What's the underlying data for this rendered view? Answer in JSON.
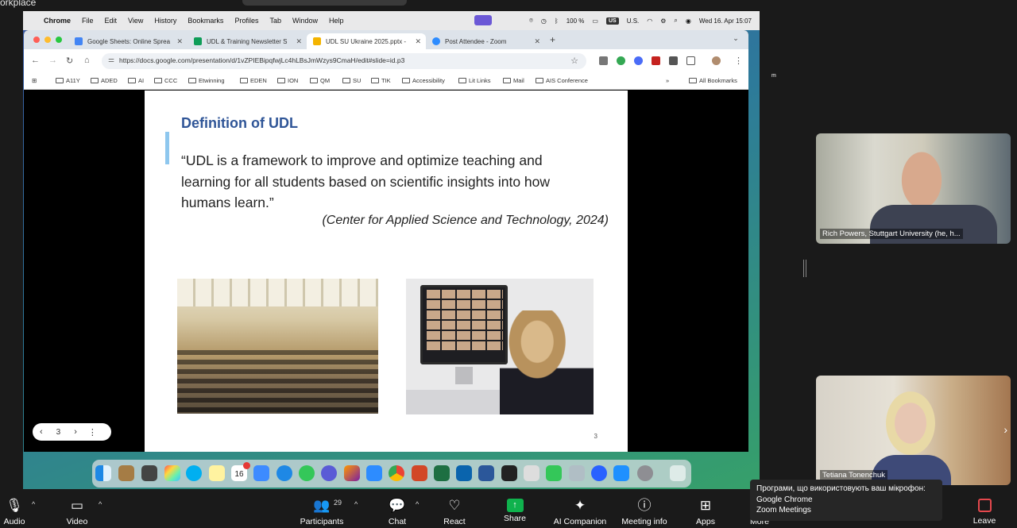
{
  "corner_text": "orkplace",
  "menubar": {
    "app": "Chrome",
    "items": [
      "File",
      "Edit",
      "View",
      "History",
      "Bookmarks",
      "Profiles",
      "Tab",
      "Window",
      "Help"
    ],
    "battery": "100 %",
    "input_source": "US",
    "input_source_label": "U.S.",
    "datetime": "Wed 16. Apr  15:07"
  },
  "browser": {
    "tabs": [
      {
        "title": "Google Sheets: Online Sprea",
        "color": "#4285f4"
      },
      {
        "title": "UDL & Training Newsletter S",
        "color": "#0f9d58"
      },
      {
        "title": "UDL SU Ukraine 2025.pptx -",
        "color": "#f4b400"
      },
      {
        "title": "Post Attendee - Zoom",
        "color": "#2d8cff"
      }
    ],
    "url": "https://docs.google.com/presentation/d/1vZPIEBipqfwjLc4hLBsJmWzys9CmaH/edit#slide=id.p3",
    "bookmarks": [
      "A11Y",
      "ADED",
      "AI",
      "CCC",
      "Etwinning",
      "EDEN",
      "ION",
      "QM",
      "SU",
      "TIK",
      "Accessibility",
      "Lit Links",
      "Mail",
      "AIS Conference"
    ],
    "all_bookmarks": "All Bookmarks"
  },
  "slide": {
    "title": "Definition of UDL",
    "quote": "“UDL is a framework to improve and optimize teaching and learning for all students based on scientific insights into how humans learn.”",
    "source": "(Center for Applied Science and Technology, 2024)",
    "page_number": "3",
    "nav_number": "3"
  },
  "dock": {
    "calendar_day": "16"
  },
  "participants": [
    {
      "name": "Rich Powers, Stuttgart University (he, h..."
    },
    {
      "name": "Tetiana Tonenchuk"
    }
  ],
  "toolbar": {
    "audio": "Audio",
    "video": "Video",
    "participants": "Participants",
    "participants_count": "29",
    "chat": "Chat",
    "react": "React",
    "share": "Share",
    "ai_companion": "AI Companion",
    "meeting_info": "Meeting info",
    "apps": "Apps",
    "more": "More",
    "leave": "Leave"
  },
  "mic_popup": {
    "title": "Програми, що використовують ваш мікрофон:",
    "app1": "Google Chrome",
    "app2": "Zoom Meetings"
  }
}
